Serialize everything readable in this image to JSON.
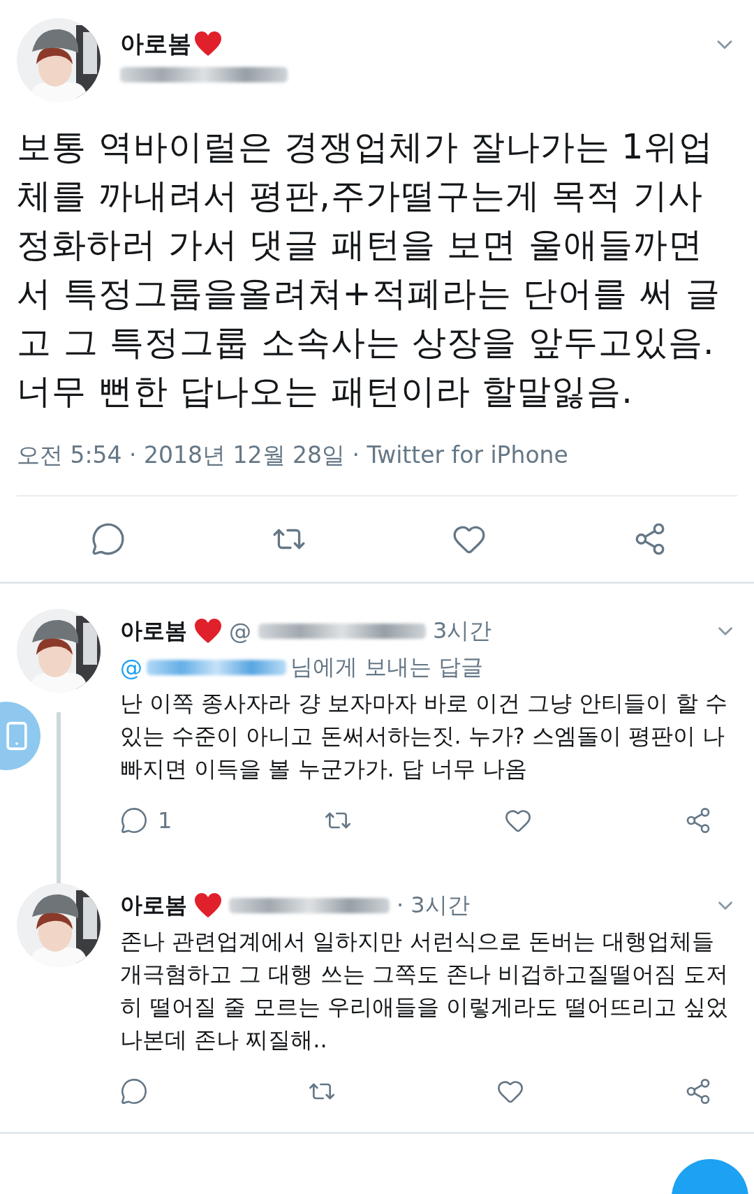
{
  "main_tweet": {
    "author": "아로봄",
    "text": "보통 역바이럴은 경쟁업체가 잘나가는 1위업체를 까내려서 평판,주가떨구는게 목적 기사정화하러 가서 댓글 패턴을 보면 울애들까면서 특정그룹을올려쳐+적폐라는 단어를 써 글고 그 특정그룹 소속사는 상장을 앞두고있음. 너무 뻔한 답나오는 패턴이라 할말잃음.",
    "timestamp": "오전 5:54 · 2018년 12월 28일 · Twitter for iPhone"
  },
  "replies": [
    {
      "author": "아로봄",
      "handle": "@",
      "time": "3시간",
      "reply_to": {
        "prefix": "@",
        "suffix": "님에게 보내는 답글"
      },
      "text": "난 이쪽 종사자라 걍 보자마자 바로 이건 그냥 안티들이 할 수 있는 수준이 아니고 돈써서하는짓. 누가? 스엠돌이 평판이 나빠지면 이득을 볼 누군가가. 답 너무 나옴",
      "reply_count": "1"
    },
    {
      "author": "아로봄",
      "time": "· 3시간",
      "text": "존나 관련업계에서 일하지만 서런식으로 돈버는 대행업체들 개극혐하고 그 대행 쓰는 그쪽도 존나 비겁하고질떨어짐 도저히 떨어질 줄 모르는 우리애들을 이렇게라도 떨어뜨리고 싶었나본데 존나 찌질해.."
    }
  ]
}
